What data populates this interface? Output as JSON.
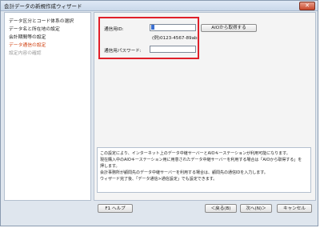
{
  "window": {
    "title": "会計データの新規作成ウィザード",
    "close_glyph": "✕"
  },
  "sidebar": {
    "items": [
      {
        "label": "データ区分とコード体系の選択",
        "state": "normal"
      },
      {
        "label": "データ名と所在地の設定",
        "state": "normal"
      },
      {
        "label": "会計期間等の設定",
        "state": "normal"
      },
      {
        "label": "データ通信の設定",
        "state": "active"
      },
      {
        "label": "設定内容の確認",
        "state": "disabled"
      }
    ]
  },
  "form": {
    "id_label": "通信用ID:",
    "id_value": "",
    "id_example": "(例)0123-4567-89ab",
    "get_button": "AIOから取得する",
    "password_label": "通信用パスワード:",
    "password_value": ""
  },
  "description": {
    "lines": [
      "この設定により、インターネット上のデータ中継サーバーとAIOキーステーションが利用可能になります。",
      "現在購入中のAIOキーステーション用に用意されたデータ中継サーバーを利用する場合は「AIOから取得する」を",
      "押します。",
      "会計事務所が顧問先のデータ中継サーバーを利用する場合は、顧問先の通信IDを入力します。",
      "ウィザード完了後、「データ通信>通信設定」でも設定できます。"
    ]
  },
  "buttons": {
    "help": "F1 ヘルプ",
    "back": "＜戻る(B)",
    "next": "次へ(N)＞",
    "cancel": "キャンセル"
  },
  "colors": {
    "accent_red": "#e0202a",
    "active_item": "#d04010",
    "selection": "#3a6fd1"
  }
}
